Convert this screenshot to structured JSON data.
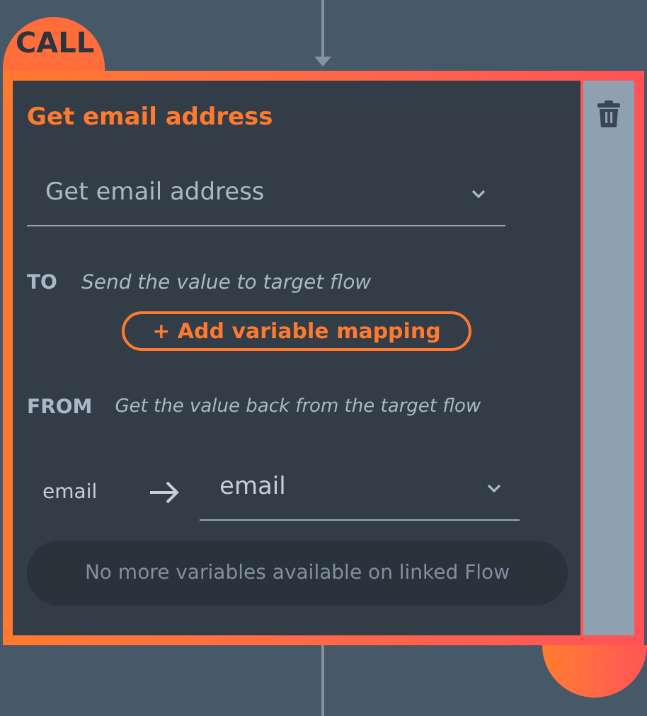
{
  "node": {
    "tag": "CALL",
    "title": "Get email address"
  },
  "flow_select": {
    "value": "Get email address"
  },
  "to": {
    "label": "TO",
    "description": "Send the value to target flow",
    "add_button": "+ Add variable mapping"
  },
  "from": {
    "label": "FROM",
    "description": "Get the value back from the target flow"
  },
  "mappings": [
    {
      "source": "email",
      "target": "email"
    }
  ],
  "info": "No more variables available on linked Flow"
}
